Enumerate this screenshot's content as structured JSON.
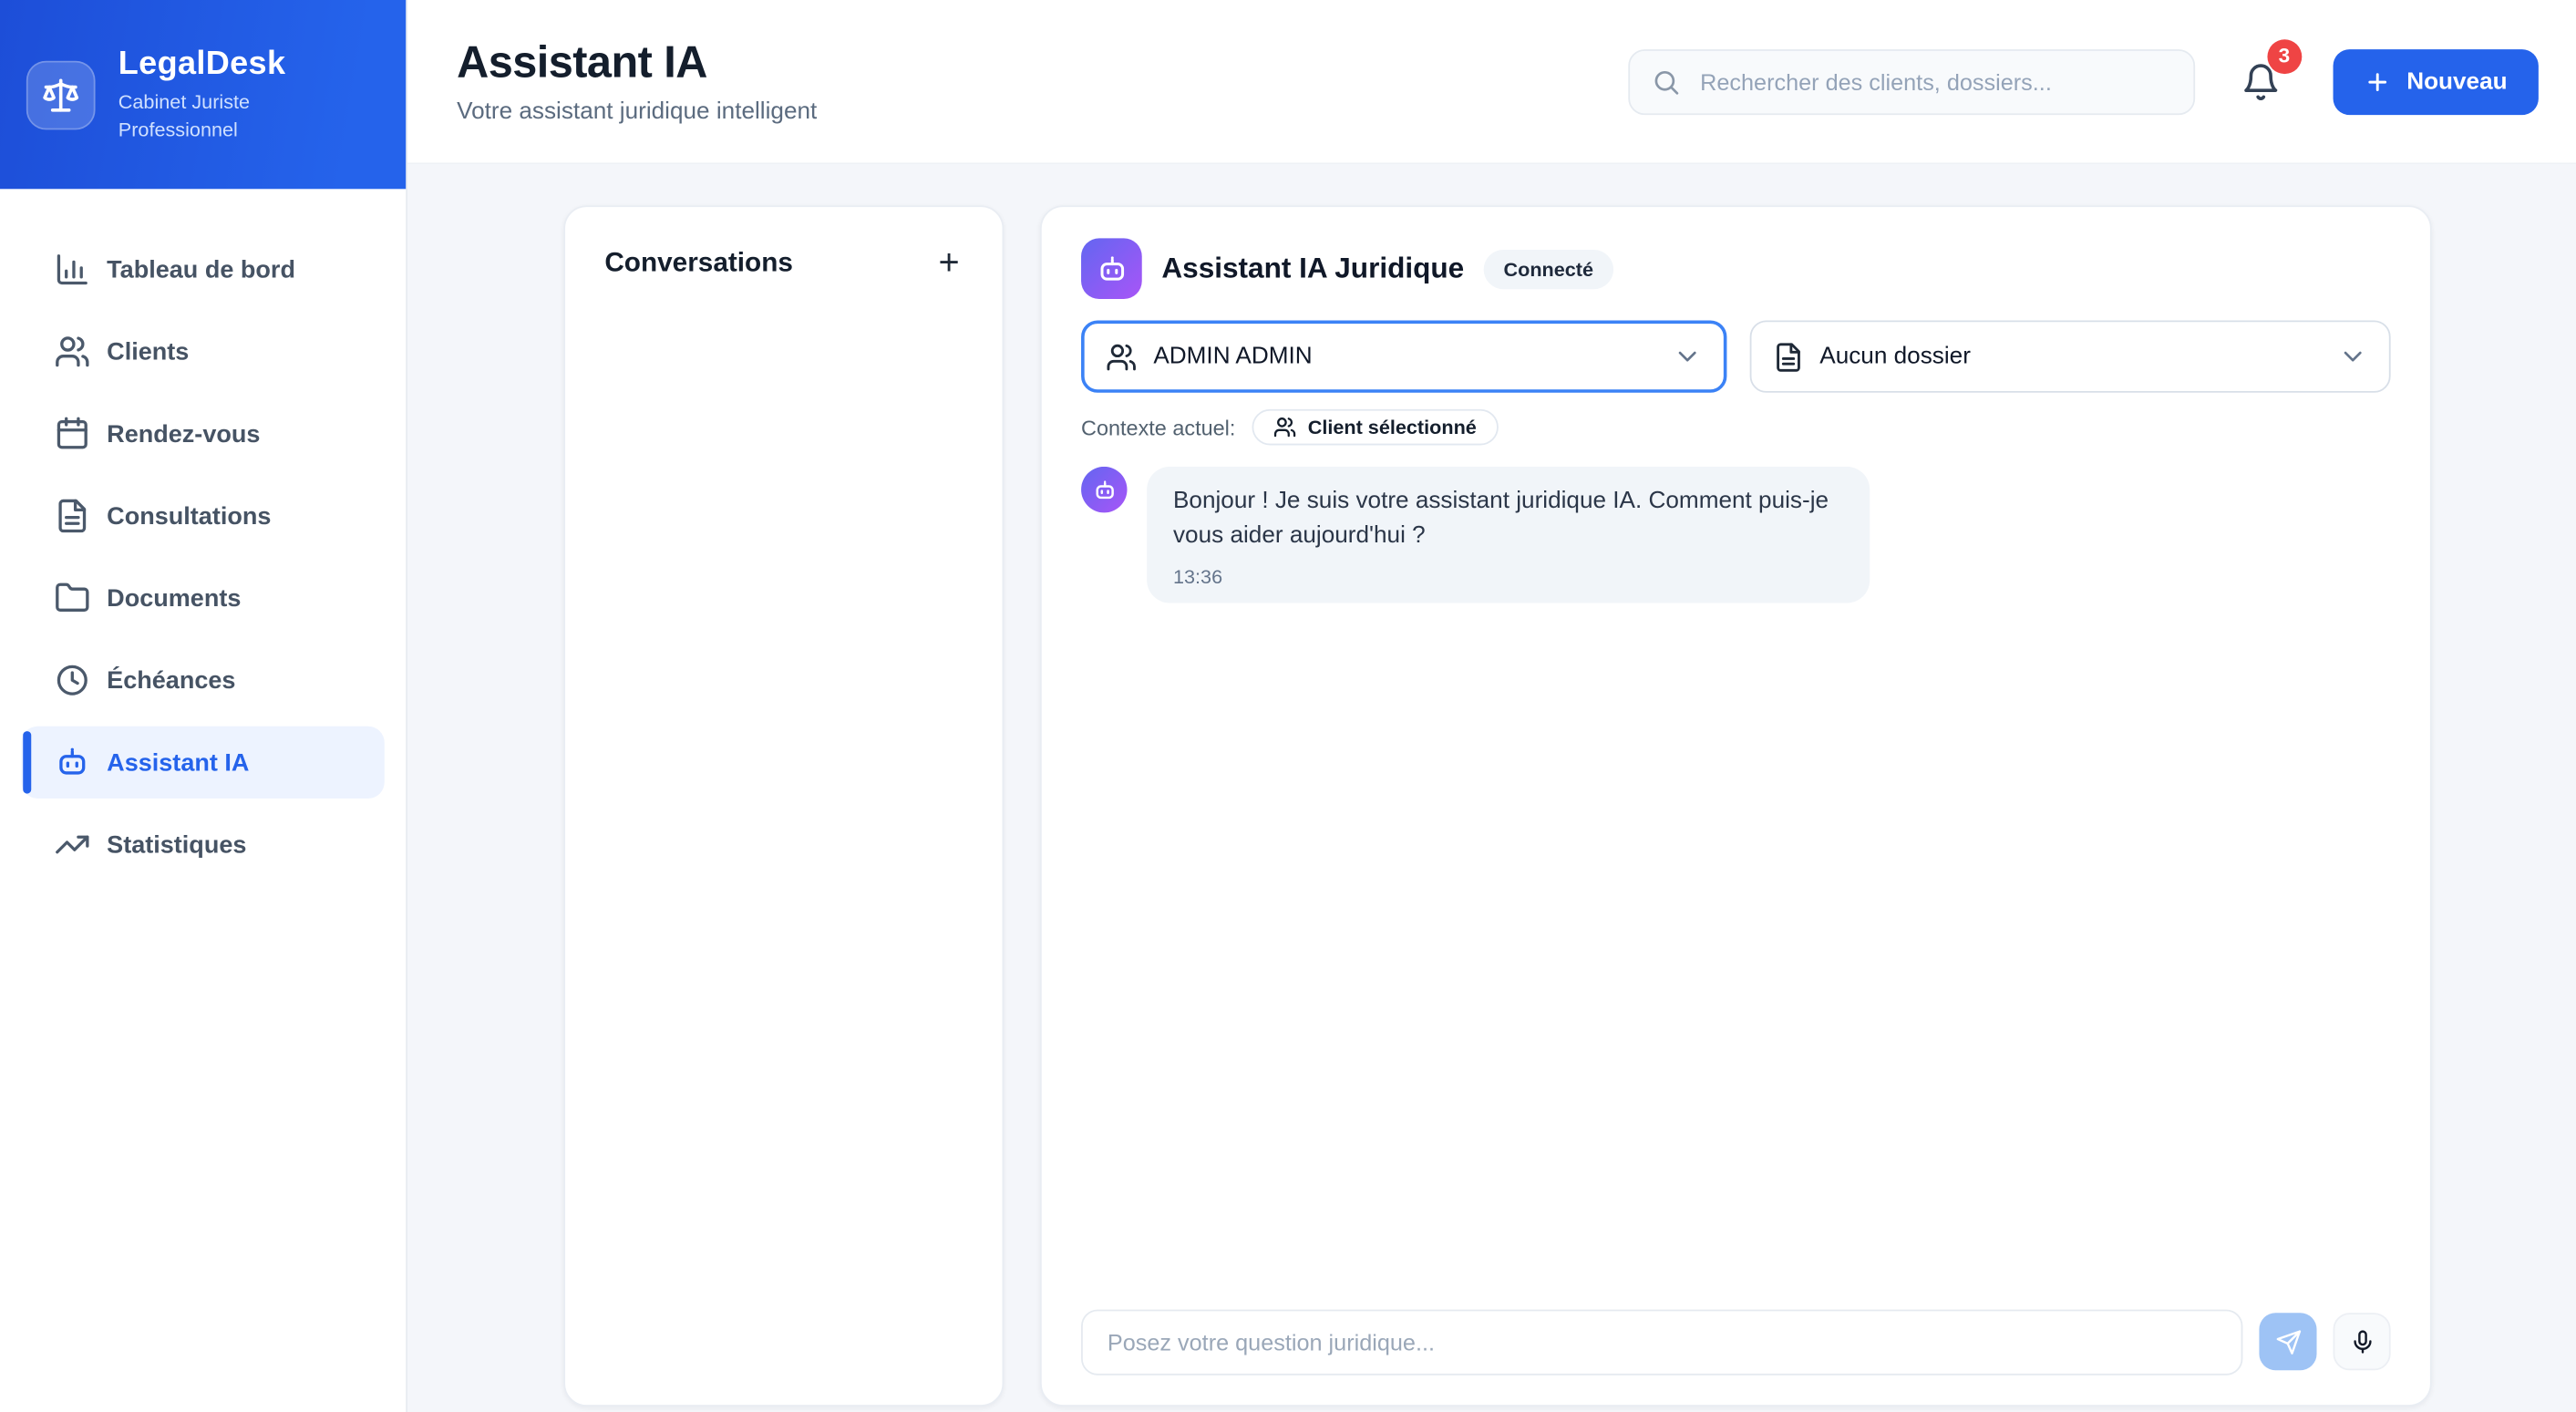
{
  "brand": {
    "name": "LegalDesk",
    "tagline": "Cabinet Juriste Professionnel"
  },
  "sidebar": {
    "items": [
      {
        "label": "Tableau de bord",
        "icon": "bar-chart-icon",
        "active": false
      },
      {
        "label": "Clients",
        "icon": "users-icon",
        "active": false
      },
      {
        "label": "Rendez-vous",
        "icon": "calendar-icon",
        "active": false
      },
      {
        "label": "Consultations",
        "icon": "file-text-icon",
        "active": false
      },
      {
        "label": "Documents",
        "icon": "folder-icon",
        "active": false
      },
      {
        "label": "Échéances",
        "icon": "clock-icon",
        "active": false
      },
      {
        "label": "Assistant IA",
        "icon": "bot-icon",
        "active": true
      },
      {
        "label": "Statistiques",
        "icon": "trending-up-icon",
        "active": false
      }
    ]
  },
  "header": {
    "title": "Assistant IA",
    "subtitle": "Votre assistant juridique intelligent",
    "search_placeholder": "Rechercher des clients, dossiers...",
    "notification_count": "3",
    "new_button": "Nouveau"
  },
  "conversations": {
    "title": "Conversations",
    "add_label": "+"
  },
  "chat": {
    "title": "Assistant IA Juridique",
    "status": "Connecté",
    "client_select": "ADMIN ADMIN",
    "dossier_select": "Aucun dossier",
    "context_label": "Contexte actuel:",
    "context_chip": "Client sélectionné",
    "messages": [
      {
        "text": "Bonjour ! Je suis votre assistant juridique IA. Comment puis-je vous aider aujourd'hui ?",
        "time": "13:36"
      }
    ],
    "input_placeholder": "Posez votre question juridique..."
  },
  "colors": {
    "accent": "#2563eb",
    "sidebar_gradient_start": "#1d4ed8",
    "sidebar_gradient_end": "#2563eb",
    "bot_gradient_start": "#6366f1",
    "bot_gradient_end": "#a855f7",
    "notification_badge": "#ef4444",
    "focus_ring": "#3b82f6",
    "bubble_bg": "#f1f5f9"
  }
}
